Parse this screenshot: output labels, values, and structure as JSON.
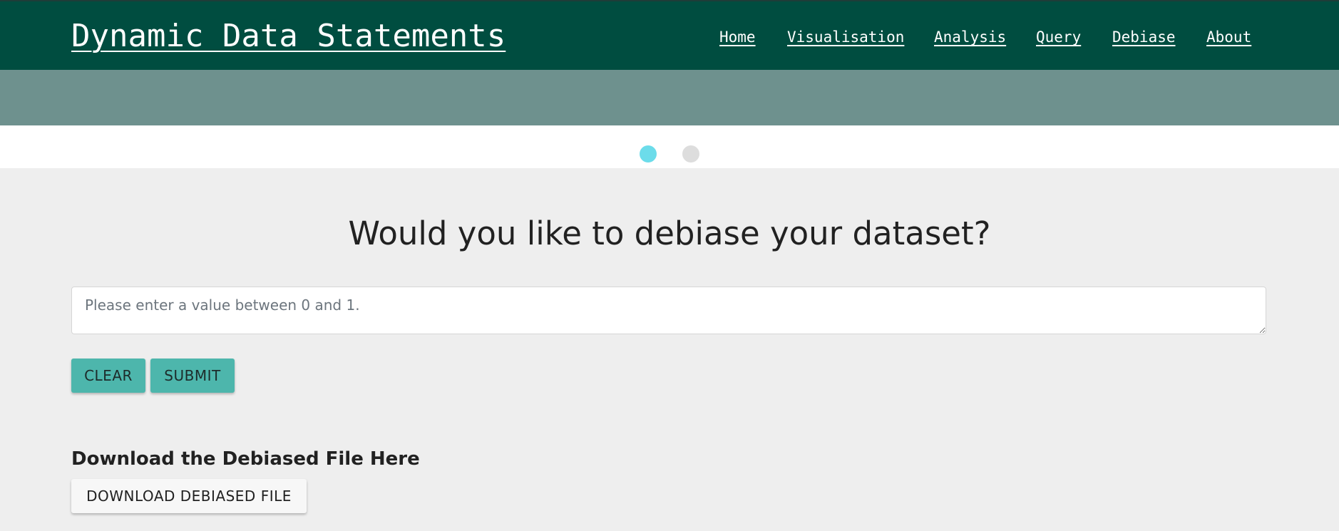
{
  "navbar": {
    "brand": "Dynamic Data Statements",
    "links": [
      {
        "label": "Home"
      },
      {
        "label": "Visualisation"
      },
      {
        "label": "Analysis"
      },
      {
        "label": "Query"
      },
      {
        "label": "Debiase"
      },
      {
        "label": "About"
      }
    ],
    "color": "#004d40"
  },
  "banner": {
    "color": "#6e918e"
  },
  "carousel": {
    "slides": 2,
    "active_index": 0,
    "active_color": "#6cdcea",
    "inactive_color": "#dddddd"
  },
  "main": {
    "heading": "Would you like to debiase your dataset?",
    "input": {
      "value": "",
      "placeholder": "Please enter a value between 0 and 1."
    },
    "clear_label": "CLEAR",
    "submit_label": "SUBMIT",
    "button_color": "#4db6ac"
  },
  "download": {
    "title": "Download the Debiased File Here",
    "button_label": "DOWNLOAD DEBIASED FILE"
  }
}
